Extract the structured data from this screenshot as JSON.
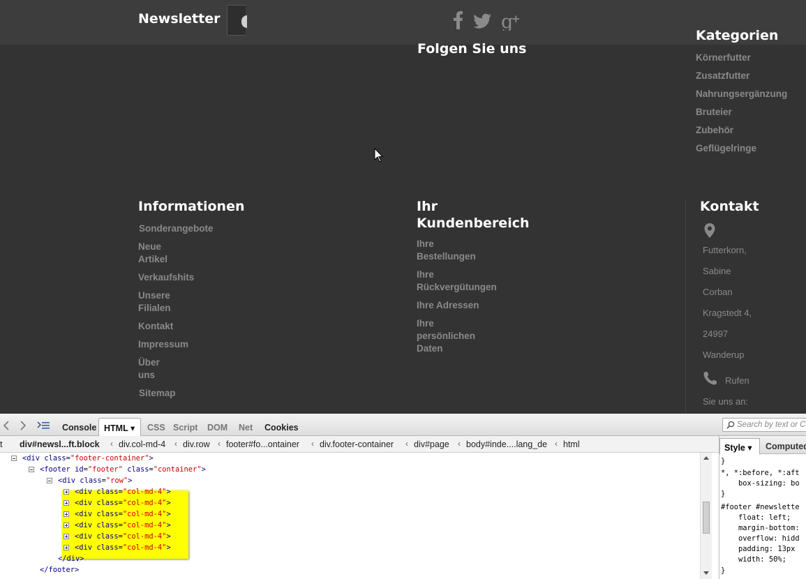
{
  "footer": {
    "newsletter_title": "Newsletter",
    "follow_title": "Folgen Sie uns",
    "social_icons": [
      "facebook-icon",
      "twitter-icon",
      "google-plus-icon"
    ],
    "kategorien": {
      "title": "Kategorien",
      "items": [
        "Körnerfutter",
        "Zusatzfutter",
        "Nahrungsergänzung",
        "Bruteier",
        "Zubehör",
        "Geflügelringe"
      ]
    },
    "informationen": {
      "title": "Informationen",
      "items": [
        "Sonderangebote",
        "Neue\nArtikel",
        "Verkaufshits",
        "Unsere\nFilialen",
        "Kontakt",
        "Impressum",
        "Über\nuns",
        "Sitemap"
      ]
    },
    "kundenbereich": {
      "title": "Ihr\nKundenbereich",
      "items": [
        "Ihre\nBestellungen",
        "Ihre\nRückvergütungen",
        "Ihre Adressen",
        "Ihre\npersönlichen\nDaten"
      ]
    },
    "kontakt": {
      "title": "Kontakt",
      "address_lines": [
        "Futterkorn,",
        "Sabine",
        "Corban",
        "Kragstedt 4,",
        "24997",
        "Wanderup"
      ],
      "phone_label": "Rufen",
      "phone_text": "Sie uns an:"
    }
  },
  "devtools": {
    "tabs": {
      "console": "Console",
      "html": "HTML ▾",
      "css": "CSS",
      "script": "Script",
      "dom": "DOM",
      "net": "Net",
      "cookies": "Cookies"
    },
    "search_placeholder": "Search by text or CSS",
    "breadcrumbs": [
      "t",
      "div#newsl...ft.block",
      "div.col-md-4",
      "div.row",
      "footer#fo...ontainer",
      "div.footer-container",
      "div#page",
      "body#inde....lang_de",
      "html"
    ],
    "html_lines": [
      {
        "tag": "div",
        "attr": "class",
        "val": "footer-container"
      },
      {
        "tag": "footer",
        "attr": "id",
        "val": "footer",
        "attr2": "class",
        "val2": "container"
      },
      {
        "tag": "div",
        "attr": "class",
        "val": "row"
      },
      {
        "tag": "div",
        "attr": "class",
        "val": "col-md-4"
      },
      {
        "tag": "div",
        "attr": "class",
        "val": "col-md-4"
      },
      {
        "tag": "div",
        "attr": "class",
        "val": "col-md-4"
      },
      {
        "tag": "div",
        "attr": "class",
        "val": "col-md-4"
      },
      {
        "tag": "div",
        "attr": "class",
        "val": "col-md-4"
      },
      {
        "tag": "div",
        "attr": "class",
        "val": "col-md-4"
      }
    ],
    "close_div": "</div>",
    "close_footer": "</footer>",
    "side_tabs": {
      "style": "Style ▾",
      "computed": "Computed"
    },
    "css_rules": [
      "}",
      "*, *:before, *:aft",
      "    box-sizing: bo",
      "}",
      "#footer #newslette",
      "    float: left;",
      "    margin-bottom:",
      "    overflow: hidd",
      "    padding: 13px",
      "    width: 50%;",
      "}"
    ]
  }
}
